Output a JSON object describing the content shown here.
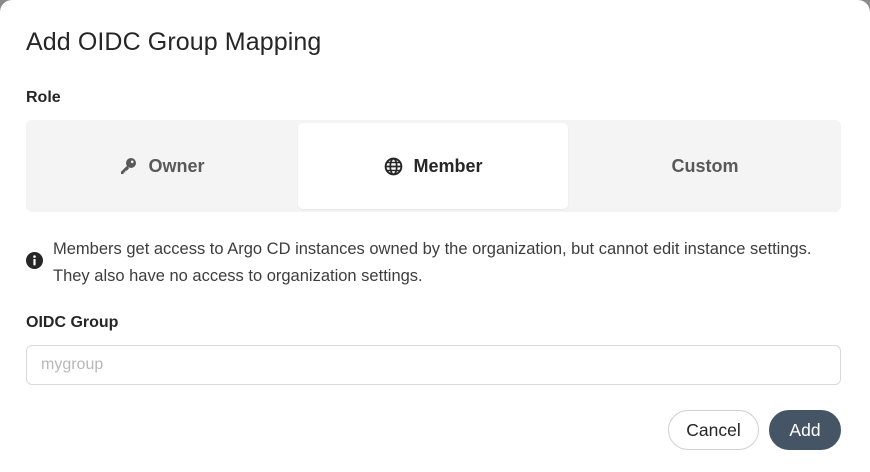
{
  "dialog": {
    "title": "Add OIDC Group Mapping"
  },
  "role": {
    "label": "Role",
    "options": [
      {
        "label": "Owner",
        "icon": "key-icon",
        "selected": false
      },
      {
        "label": "Member",
        "icon": "globe-icon",
        "selected": true
      },
      {
        "label": "Custom",
        "icon": "",
        "selected": false
      }
    ]
  },
  "info": {
    "icon": "info-circle-icon",
    "text": "Members get access to Argo CD instances owned by the organization, but cannot edit instance settings. They also have no access to organization settings."
  },
  "oidc_group": {
    "label": "OIDC Group",
    "value": "",
    "placeholder": "mygroup"
  },
  "actions": {
    "cancel_label": "Cancel",
    "add_label": "Add"
  },
  "colors": {
    "primary_button": "#465566",
    "segment_bg": "#f4f4f4",
    "text": "#262626"
  }
}
